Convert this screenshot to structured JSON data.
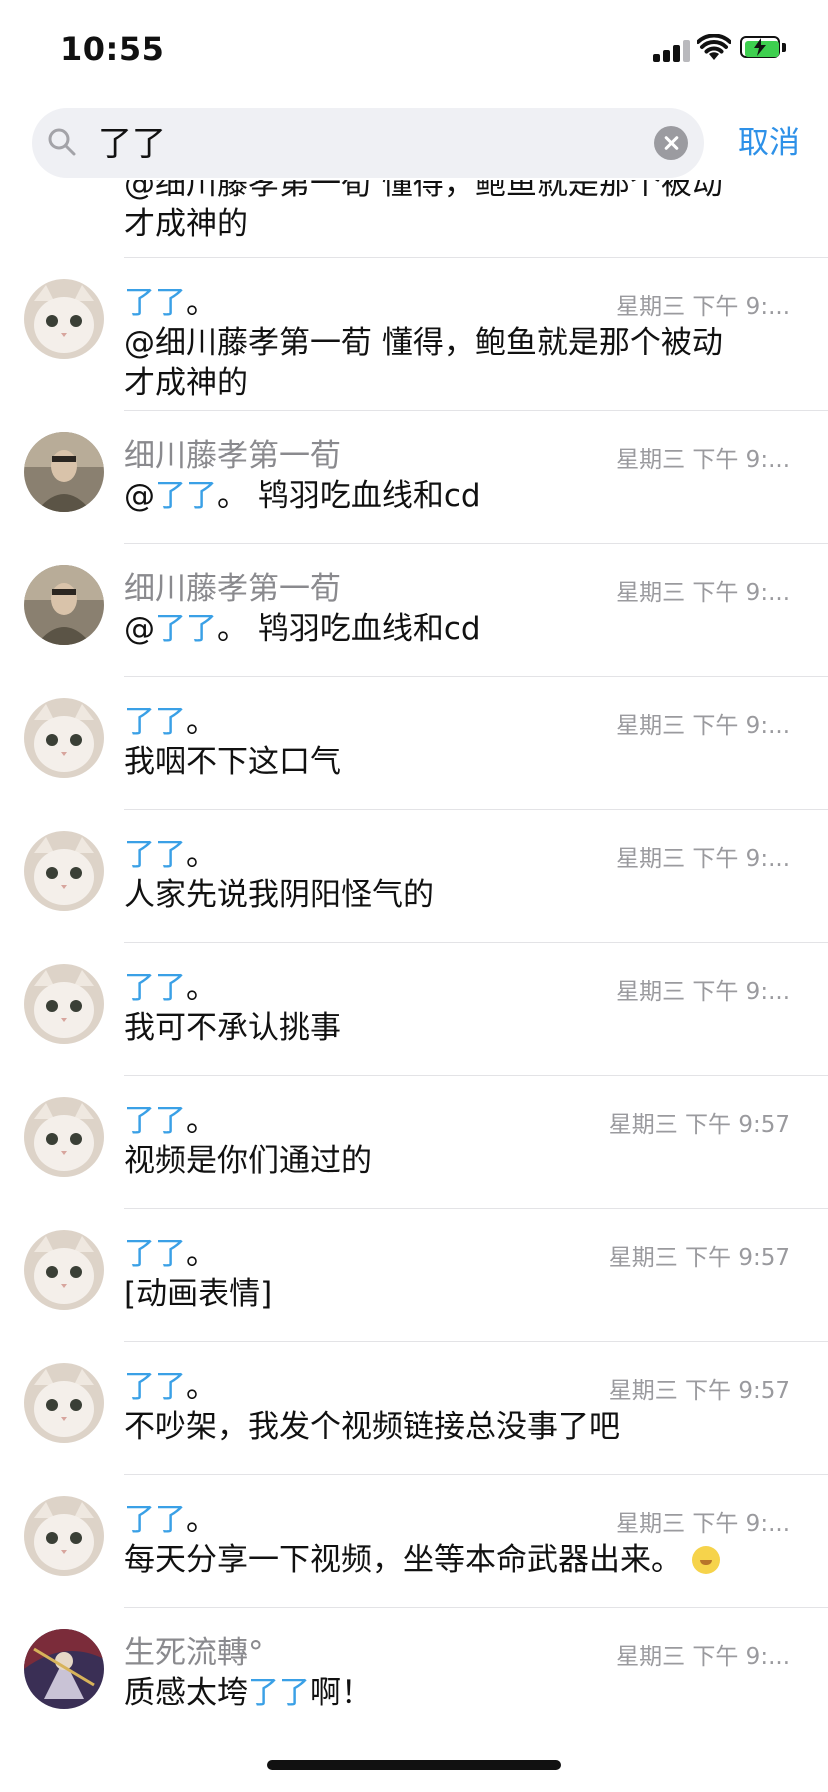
{
  "status": {
    "time": "10:55"
  },
  "search": {
    "query": "了了",
    "cancel_label": "取消"
  },
  "truncated_top": {
    "hidden_line": "@细川藤孝第一荀 懂得，鲍鱼就是那个被动",
    "line": "才成神的"
  },
  "messages": [
    {
      "name_hl": "了了",
      "name_tail": "。",
      "time": "星期三 下午 9:...",
      "text": "@细川藤孝第一荀 懂得，鲍鱼就是那个被动",
      "text2": "才成神的",
      "avatar": "cat"
    },
    {
      "name": "细川藤孝第一荀",
      "time": "星期三 下午 9:...",
      "text_pre": "@",
      "text_hl": "了了",
      "text_post": "。 鸨羽吃血线和cd",
      "avatar": "man"
    },
    {
      "name": "细川藤孝第一荀",
      "time": "星期三 下午 9:...",
      "text_pre": "@",
      "text_hl": "了了",
      "text_post": "。 鸨羽吃血线和cd",
      "avatar": "man"
    },
    {
      "name_hl": "了了",
      "name_tail": "。",
      "time": "星期三 下午 9:...",
      "text": "我咽不下这口气",
      "avatar": "cat"
    },
    {
      "name_hl": "了了",
      "name_tail": "。",
      "time": "星期三 下午 9:...",
      "text": "人家先说我阴阳怪气的",
      "avatar": "cat"
    },
    {
      "name_hl": "了了",
      "name_tail": "。",
      "time": "星期三 下午 9:...",
      "text": "我可不承认挑事",
      "avatar": "cat"
    },
    {
      "name_hl": "了了",
      "name_tail": "。",
      "time": "星期三 下午 9:57",
      "text": "视频是你们通过的",
      "avatar": "cat"
    },
    {
      "name_hl": "了了",
      "name_tail": "。",
      "time": "星期三 下午 9:57",
      "text": "[动画表情]",
      "avatar": "cat"
    },
    {
      "name_hl": "了了",
      "name_tail": "。",
      "time": "星期三 下午 9:57",
      "text": "不吵架，我发个视频链接总没事了吧",
      "avatar": "cat"
    },
    {
      "name_hl": "了了",
      "name_tail": "。",
      "time": "星期三 下午 9:...",
      "text": "每天分享一下视频，坐等本命武器出来。",
      "emoji": "emoji-icon",
      "avatar": "cat"
    },
    {
      "name": "生死流轉°",
      "time": "星期三 下午 9:...",
      "text_pre": "质感太垮",
      "text_hl": "了了",
      "text_post": "啊！",
      "avatar": "art"
    }
  ]
}
